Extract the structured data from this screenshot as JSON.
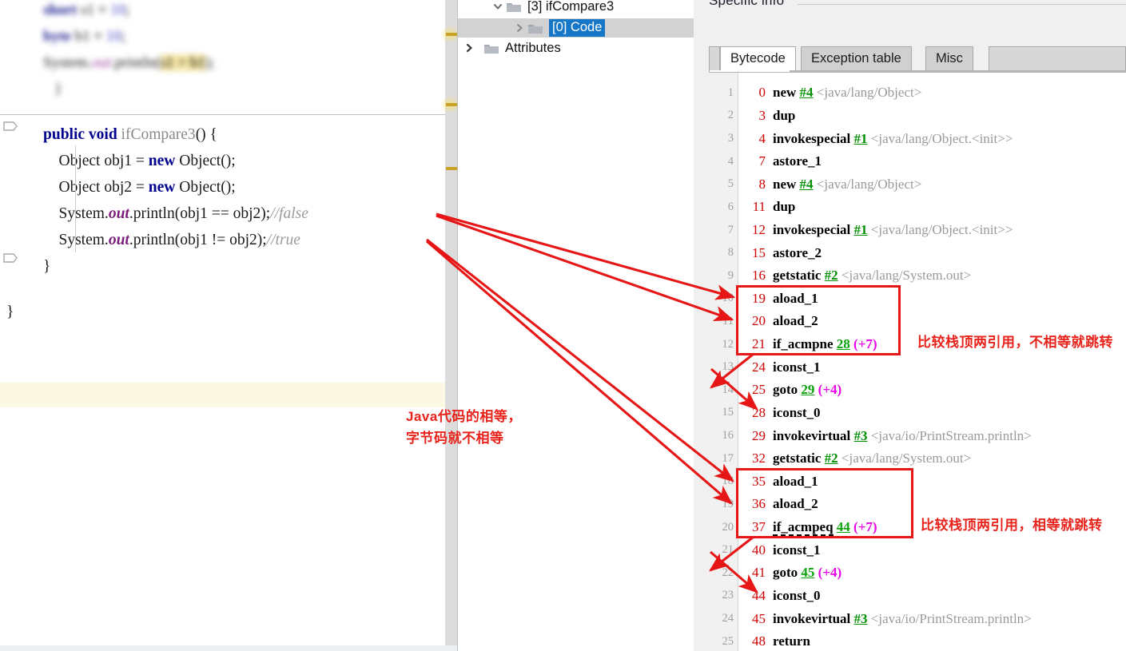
{
  "editor": {
    "blurred_code": [
      "Short s1 = 10;",
      "byte b1 = 10;",
      "System.out.println(s1 > b1);"
    ],
    "lines": [
      {
        "id": "sig",
        "text": "public void ifCompare3() {"
      },
      {
        "id": "obj1",
        "text": "Object obj1 = new Object();"
      },
      {
        "id": "obj2",
        "text": "Object obj2 = new Object();"
      },
      {
        "id": "print1",
        "text": "System.out.println(obj1 == obj2);//false"
      },
      {
        "id": "print2",
        "text": "System.out.println(obj1 != obj2);//true"
      },
      {
        "id": "close1",
        "text": "}"
      },
      {
        "id": "close2",
        "text": "}"
      }
    ],
    "comment_false": "//false",
    "comment_true": "//true",
    "method_name": "ifCompare3",
    "keyword_public": "public",
    "keyword_void": "void",
    "keyword_new": "new",
    "type_object": "Object",
    "field_out": "out"
  },
  "tree": {
    "items": [
      {
        "label": "[3] ifCompare3",
        "expanded": true,
        "selected": false,
        "indent": 2,
        "twisty": "chevron-down-icon"
      },
      {
        "label": "[0] Code",
        "expanded": false,
        "selected": true,
        "indent": 3,
        "twisty": "chevron-right-icon"
      },
      {
        "label": "Attributes",
        "expanded": false,
        "selected": false,
        "indent": 0,
        "twisty": "chevron-right-icon"
      }
    ]
  },
  "right_panel": {
    "title": "Specific info",
    "tabs": [
      {
        "label": "Bytecode",
        "active": true
      },
      {
        "label": "Exception table",
        "active": false
      },
      {
        "label": "Misc",
        "active": false
      }
    ]
  },
  "bytecode": {
    "rows": [
      {
        "line": "1",
        "offset": "0",
        "op": "new",
        "ref": "#4",
        "desc": "<java/lang/Object>",
        "jump": "",
        "delta": ""
      },
      {
        "line": "2",
        "offset": "3",
        "op": "dup",
        "ref": "",
        "desc": "",
        "jump": "",
        "delta": ""
      },
      {
        "line": "3",
        "offset": "4",
        "op": "invokespecial",
        "ref": "#1",
        "desc": "<java/lang/Object.<init>>",
        "jump": "",
        "delta": ""
      },
      {
        "line": "4",
        "offset": "7",
        "op": "astore_1",
        "ref": "",
        "desc": "",
        "jump": "",
        "delta": ""
      },
      {
        "line": "5",
        "offset": "8",
        "op": "new",
        "ref": "#4",
        "desc": "<java/lang/Object>",
        "jump": "",
        "delta": ""
      },
      {
        "line": "6",
        "offset": "11",
        "op": "dup",
        "ref": "",
        "desc": "",
        "jump": "",
        "delta": ""
      },
      {
        "line": "7",
        "offset": "12",
        "op": "invokespecial",
        "ref": "#1",
        "desc": "<java/lang/Object.<init>>",
        "jump": "",
        "delta": ""
      },
      {
        "line": "8",
        "offset": "15",
        "op": "astore_2",
        "ref": "",
        "desc": "",
        "jump": "",
        "delta": ""
      },
      {
        "line": "9",
        "offset": "16",
        "op": "getstatic",
        "ref": "#2",
        "desc": "<java/lang/System.out>",
        "jump": "",
        "delta": ""
      },
      {
        "line": "10",
        "offset": "19",
        "op": "aload_1",
        "ref": "",
        "desc": "",
        "jump": "",
        "delta": ""
      },
      {
        "line": "11",
        "offset": "20",
        "op": "aload_2",
        "ref": "",
        "desc": "",
        "jump": "",
        "delta": ""
      },
      {
        "line": "12",
        "offset": "21",
        "op": "if_acmpne",
        "ref": "",
        "desc": "",
        "jump": "28",
        "delta": "(+7)"
      },
      {
        "line": "13",
        "offset": "24",
        "op": "iconst_1",
        "ref": "",
        "desc": "",
        "jump": "",
        "delta": ""
      },
      {
        "line": "14",
        "offset": "25",
        "op": "goto",
        "ref": "",
        "desc": "",
        "jump": "29",
        "delta": "(+4)"
      },
      {
        "line": "15",
        "offset": "28",
        "op": "iconst_0",
        "ref": "",
        "desc": "",
        "jump": "",
        "delta": ""
      },
      {
        "line": "16",
        "offset": "29",
        "op": "invokevirtual",
        "ref": "#3",
        "desc": "<java/io/PrintStream.println>",
        "jump": "",
        "delta": ""
      },
      {
        "line": "17",
        "offset": "32",
        "op": "getstatic",
        "ref": "#2",
        "desc": "<java/lang/System.out>",
        "jump": "",
        "delta": ""
      },
      {
        "line": "18",
        "offset": "35",
        "op": "aload_1",
        "ref": "",
        "desc": "",
        "jump": "",
        "delta": ""
      },
      {
        "line": "19",
        "offset": "36",
        "op": "aload_2",
        "ref": "",
        "desc": "",
        "jump": "",
        "delta": ""
      },
      {
        "line": "20",
        "offset": "37",
        "op": "if_acmpeq",
        "ref": "",
        "desc": "",
        "jump": "44",
        "delta": "(+7)"
      },
      {
        "line": "21",
        "offset": "40",
        "op": "iconst_1",
        "ref": "",
        "desc": "",
        "jump": "",
        "delta": ""
      },
      {
        "line": "22",
        "offset": "41",
        "op": "goto",
        "ref": "",
        "desc": "",
        "jump": "45",
        "delta": "(+4)"
      },
      {
        "line": "23",
        "offset": "44",
        "op": "iconst_0",
        "ref": "",
        "desc": "",
        "jump": "",
        "delta": ""
      },
      {
        "line": "24",
        "offset": "45",
        "op": "invokevirtual",
        "ref": "#3",
        "desc": "<java/io/PrintStream.println>",
        "jump": "",
        "delta": ""
      },
      {
        "line": "25",
        "offset": "48",
        "op": "return",
        "ref": "",
        "desc": "",
        "jump": "",
        "delta": ""
      }
    ]
  },
  "annotations": {
    "accent_color": "#e8231b",
    "note_center_line1": "Java代码的相等，",
    "note_center_line2": "字节码就不相等",
    "note_acmpne": "比较栈顶两引用，不相等就跳转",
    "note_acmpeq": "比较栈顶两引用，相等就跳转"
  }
}
